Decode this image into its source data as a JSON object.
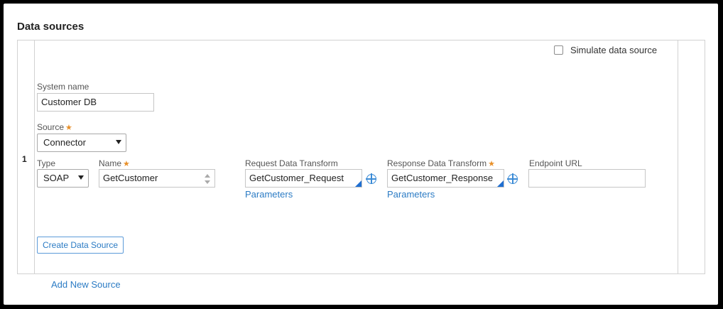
{
  "section": {
    "title": "Data sources"
  },
  "row": {
    "number": "1"
  },
  "simulate": {
    "label": "Simulate data source",
    "checked": false
  },
  "system_name": {
    "label": "System name",
    "value": "Customer DB"
  },
  "source": {
    "label": "Source",
    "required_mark": "★",
    "value": "Connector"
  },
  "type": {
    "label": "Type",
    "value": "SOAP"
  },
  "name": {
    "label": "Name",
    "required_mark": "★",
    "value": "GetCustomer"
  },
  "request_dt": {
    "label": "Request Data Transform",
    "value": "GetCustomer_Request",
    "params_link": "Parameters"
  },
  "response_dt": {
    "label": "Response Data Transform",
    "required_mark": "★",
    "value": "GetCustomer_Response",
    "params_link": "Parameters"
  },
  "endpoint": {
    "label": "Endpoint URL",
    "value": ""
  },
  "buttons": {
    "create": "Create Data Source"
  },
  "links": {
    "add_new": "Add New Source"
  },
  "colors": {
    "link": "#2b7bc4",
    "required": "#e8902a",
    "accent_corner": "#1f6fd1"
  }
}
